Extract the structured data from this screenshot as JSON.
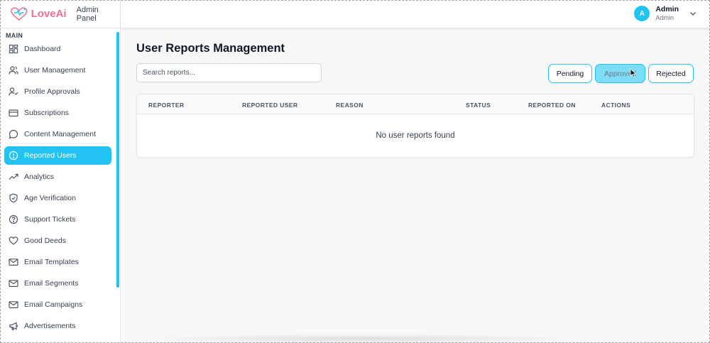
{
  "brand": {
    "name": "LoveAi",
    "subtitle": "Admin Panel"
  },
  "user": {
    "initial": "A",
    "name": "Admin",
    "role": "Admin"
  },
  "sidebar": {
    "section": "MAIN",
    "items": [
      {
        "label": "Dashboard",
        "icon": "dashboard-icon"
      },
      {
        "label": "User Management",
        "icon": "users-icon"
      },
      {
        "label": "Profile Approvals",
        "icon": "user-check-icon"
      },
      {
        "label": "Subscriptions",
        "icon": "credit-card-icon"
      },
      {
        "label": "Content Management",
        "icon": "message-circle-icon"
      },
      {
        "label": "Reported Users",
        "icon": "alert-circle-icon",
        "active": true
      },
      {
        "label": "Analytics",
        "icon": "trending-up-icon"
      },
      {
        "label": "Age Verification",
        "icon": "shield-check-icon"
      },
      {
        "label": "Support Tickets",
        "icon": "help-circle-icon"
      },
      {
        "label": "Good Deeds",
        "icon": "heart-icon"
      },
      {
        "label": "Email Templates",
        "icon": "mail-icon"
      },
      {
        "label": "Email Segments",
        "icon": "mail-icon"
      },
      {
        "label": "Email Campaigns",
        "icon": "mail-icon"
      },
      {
        "label": "Advertisements",
        "icon": "megaphone-icon"
      }
    ]
  },
  "main": {
    "title": "User Reports Management",
    "search_placeholder": "Search reports...",
    "filters": {
      "pending": "Pending",
      "approved": "Approved",
      "rejected": "Rejected"
    },
    "table": {
      "columns": [
        "REPORTER",
        "REPORTED USER",
        "REASON",
        "STATUS",
        "REPORTED ON",
        "ACTIONS"
      ],
      "empty_message": "No user reports found"
    }
  },
  "colors": {
    "accent": "#22c3f3",
    "brand": "#ee7190"
  }
}
